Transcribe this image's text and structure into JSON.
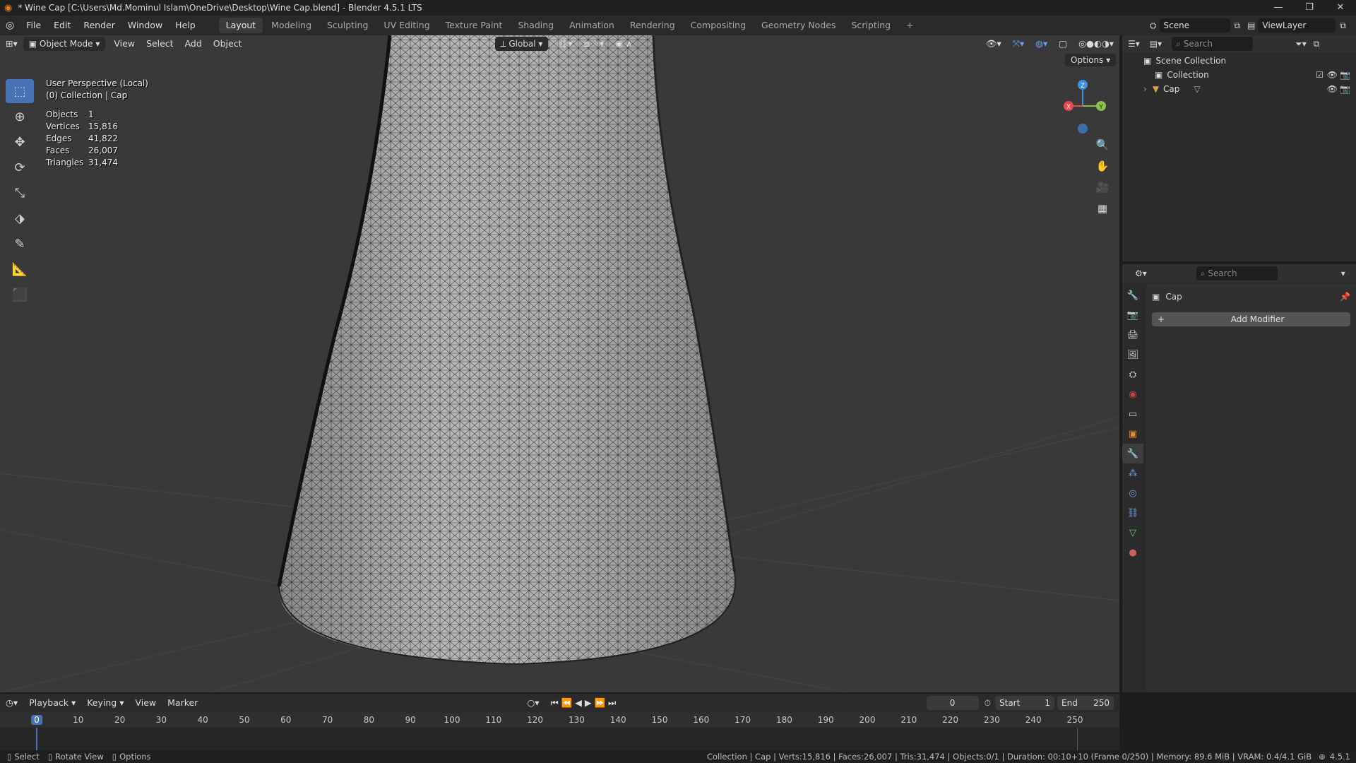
{
  "window": {
    "title": "* Wine Cap [C:\\Users\\Md.Mominul Islam\\OneDrive\\Desktop\\Wine Cap.blend] - Blender 4.5.1 LTS",
    "controls": [
      "—",
      "❐",
      "✕"
    ]
  },
  "menu": {
    "items": [
      "File",
      "Edit",
      "Render",
      "Window",
      "Help"
    ],
    "workspaces": [
      "Layout",
      "Modeling",
      "Sculpting",
      "UV Editing",
      "Texture Paint",
      "Shading",
      "Animation",
      "Rendering",
      "Compositing",
      "Geometry Nodes",
      "Scripting"
    ],
    "active_workspace": "Layout",
    "add_workspace": "+",
    "scene": "Scene",
    "view_layer": "ViewLayer"
  },
  "viewport": {
    "mode": "Object Mode",
    "header_menus": [
      "View",
      "Select",
      "Add",
      "Object"
    ],
    "orientation": "Global",
    "options_label": "Options",
    "info_line1": "User Perspective (Local)",
    "info_line2": "(0) Collection | Cap",
    "stats": [
      {
        "label": "Objects",
        "value": "1"
      },
      {
        "label": "Vertices",
        "value": "15,816"
      },
      {
        "label": "Edges",
        "value": "41,822"
      },
      {
        "label": "Faces",
        "value": "26,007"
      },
      {
        "label": "Triangles",
        "value": "31,474"
      }
    ],
    "gizmo_axes": {
      "x": "X",
      "y": "Y",
      "z": "Z"
    },
    "colors": {
      "background": "#393939",
      "axis_x": "#e5484d",
      "axis_y": "#8bc34a",
      "axis_z": "#3d8fe0",
      "active_tool": "#4772b3"
    }
  },
  "outliner": {
    "search_placeholder": "Search",
    "root": "Scene Collection",
    "items": [
      {
        "label": "Collection"
      },
      {
        "label": "Cap"
      }
    ]
  },
  "properties": {
    "search_placeholder": "Search",
    "object_name": "Cap",
    "add_modifier_label": "Add Modifier"
  },
  "timeline": {
    "menus": [
      "Playback",
      "Keying",
      "View",
      "Marker"
    ],
    "current_frame": "0",
    "start_label": "Start",
    "start_value": "1",
    "end_label": "End",
    "end_value": "250",
    "ruler_ticks": [
      "0",
      "10",
      "20",
      "30",
      "40",
      "50",
      "60",
      "70",
      "80",
      "90",
      "100",
      "110",
      "120",
      "130",
      "140",
      "150",
      "160",
      "170",
      "180",
      "190",
      "200",
      "210",
      "220",
      "230",
      "240",
      "250"
    ]
  },
  "statusbar": {
    "hints": [
      "Select",
      "Rotate View",
      "Options"
    ],
    "info": "Collection | Cap | Verts:15,816 | Faces:26,007 | Tris:31,474 | Objects:0/1 | Duration: 00:10+10 (Frame 0/250) | Memory: 89.6 MiB | VRAM: 0.4/4.1 GiB",
    "version": "4.5.1"
  }
}
